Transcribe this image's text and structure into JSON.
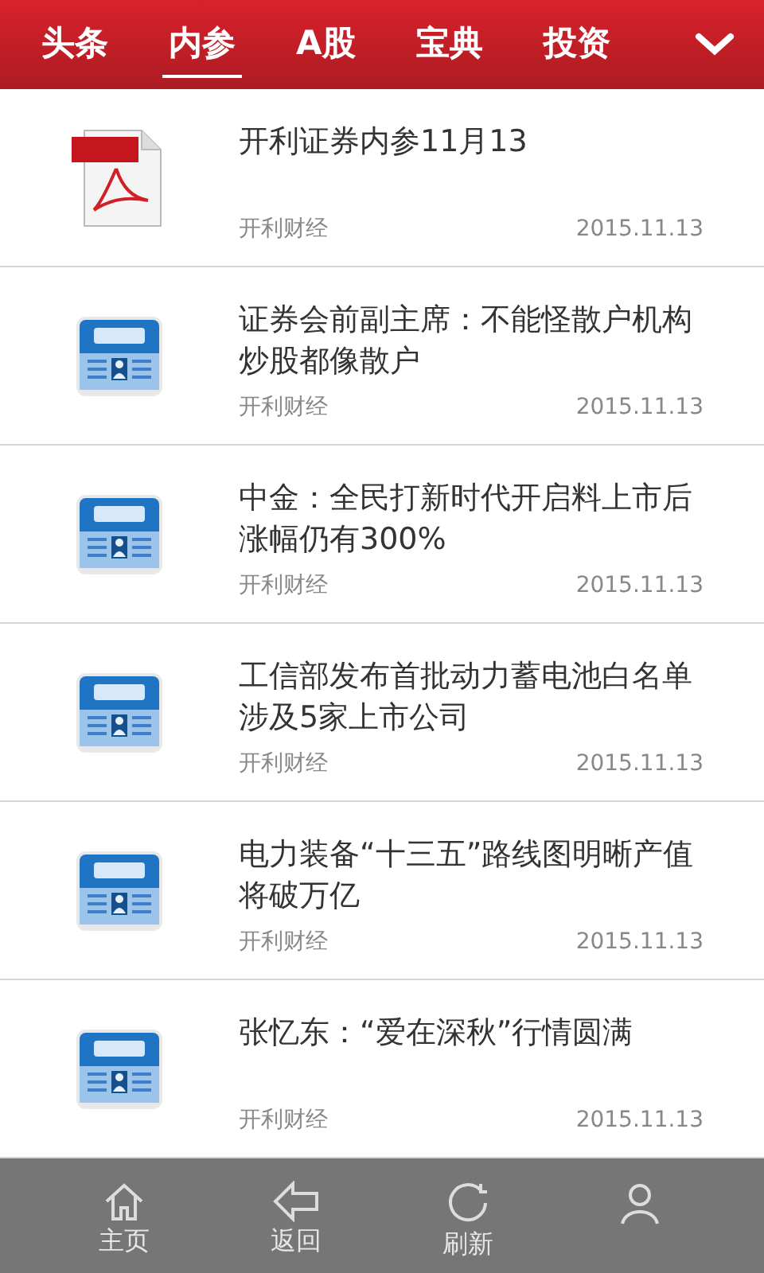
{
  "tabs": [
    {
      "label": "头条",
      "selected": false
    },
    {
      "label": "内参",
      "selected": true
    },
    {
      "label": "A股",
      "selected": false
    },
    {
      "label": "宝典",
      "selected": false
    },
    {
      "label": "投资",
      "selected": false
    }
  ],
  "articles": [
    {
      "kind": "pdf",
      "title": "开利证券内参11月13",
      "source": "开利财经",
      "date": "2015.11.13"
    },
    {
      "kind": "news",
      "title": "证券会前副主席：不能怪散户机构炒股都像散户",
      "source": "开利财经",
      "date": "2015.11.13"
    },
    {
      "kind": "news",
      "title": "中金：全民打新时代开启料上市后涨幅仍有300%",
      "source": "开利财经",
      "date": "2015.11.13"
    },
    {
      "kind": "news",
      "title": "工信部发布首批动力蓄电池白名单涉及5家上市公司",
      "source": "开利财经",
      "date": "2015.11.13"
    },
    {
      "kind": "news",
      "title": "电力装备“十三五”路线图明晰产值将破万亿",
      "source": "开利财经",
      "date": "2015.11.13"
    },
    {
      "kind": "news",
      "title": "张忆东：“爱在深秋”行情圆满",
      "source": "开利财经",
      "date": "2015.11.13"
    }
  ],
  "bottom_nav": [
    {
      "kind": "home",
      "label": "主页"
    },
    {
      "kind": "back",
      "label": "返回"
    },
    {
      "kind": "refresh",
      "label": "刷新"
    },
    {
      "kind": "user"
    }
  ]
}
